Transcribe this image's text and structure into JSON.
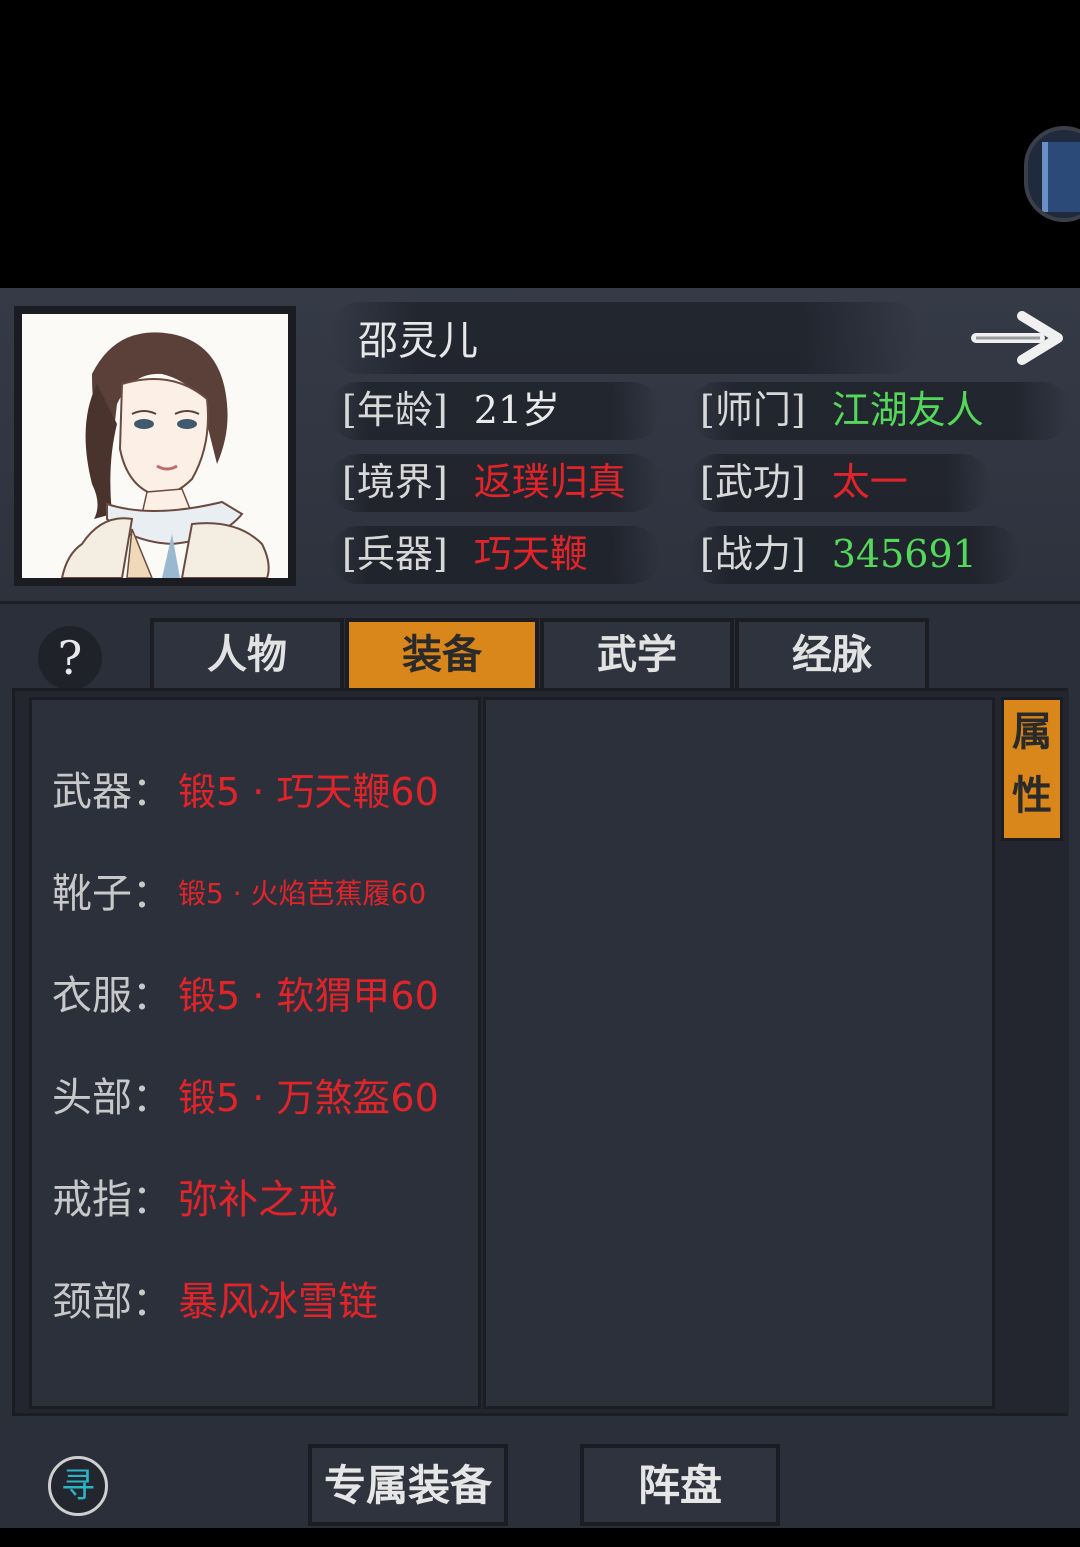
{
  "character": {
    "name": "邵灵儿",
    "stats": {
      "age": {
        "label": "[年龄]",
        "value": "21岁"
      },
      "sect": {
        "label": "[师门]",
        "value": "江湖友人"
      },
      "realm": {
        "label": "[境界]",
        "value": "返璞归真"
      },
      "martial": {
        "label": "[武功]",
        "value": "太一"
      },
      "weapon": {
        "label": "[兵器]",
        "value": "巧天鞭"
      },
      "power": {
        "label": "[战力]",
        "value": "345691"
      }
    }
  },
  "tabs": {
    "help": "?",
    "items": [
      {
        "label": "人物",
        "active": false
      },
      {
        "label": "装备",
        "active": true
      },
      {
        "label": "武学",
        "active": false
      },
      {
        "label": "经脉",
        "active": false
      }
    ]
  },
  "side_tab": {
    "line1": "属",
    "line2": "性"
  },
  "equipment": [
    {
      "slot": "武器：",
      "item": "锻5 · 巧天鞭60"
    },
    {
      "slot": "靴子：",
      "item": "锻5 · 火焰芭蕉履60"
    },
    {
      "slot": "衣服：",
      "item": "锻5 · 软猬甲60"
    },
    {
      "slot": "头部：",
      "item": "锻5 · 万煞盔60"
    },
    {
      "slot": "戒指：",
      "item": "弥补之戒"
    },
    {
      "slot": "颈部：",
      "item": "暴风冰雪链"
    }
  ],
  "bottom": {
    "seek_glyph": "寻",
    "exclusive_equipment": "专属装备",
    "formation": "阵盘"
  },
  "colors": {
    "accent": "#d9871a",
    "red": "#e0242a",
    "green": "#54d85a",
    "panel": "#2b2f3a"
  }
}
